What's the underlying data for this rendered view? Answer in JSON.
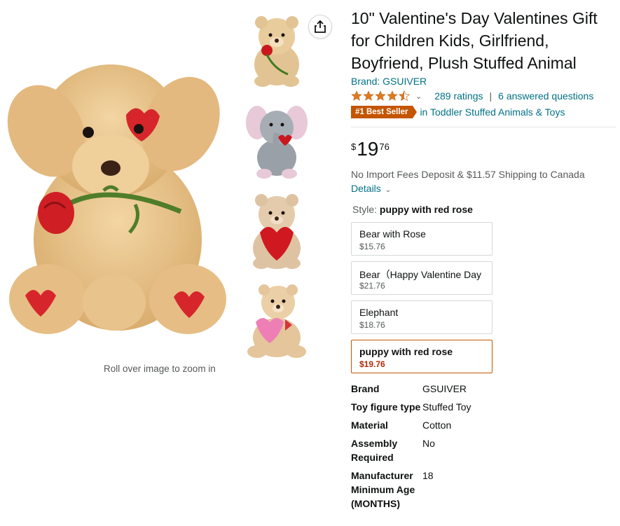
{
  "product": {
    "title": "10\" Valentine's Day Valentines Gift for Children Kids, Girlfriend, Boyfriend, Plush Stuffed Animal",
    "brand_link": "Brand: GSUIVER",
    "rating_value": 4.5,
    "ratings_count": "289 ratings",
    "answered_questions": "6 answered questions",
    "badge": "#1 Best Seller",
    "category_link": "in Toddler Stuffed Animals & Toys",
    "price": {
      "symbol": "$",
      "whole": "19",
      "fraction": "76"
    },
    "shipping": "No Import Fees Deposit & $11.57 Shipping to Canada",
    "details_link": "Details"
  },
  "gallery": {
    "zoom_hint": "Roll over image to zoom in",
    "thumbnails": [
      "bear-with-rose",
      "elephant",
      "bear-i-love-you",
      "bear-happy-valentine"
    ]
  },
  "style": {
    "label": "Style:",
    "selected": "puppy with red rose",
    "options": [
      {
        "name": "Bear with Rose",
        "price": "$15.76"
      },
      {
        "name": "Bear（Happy Valentine Day",
        "price": "$21.76"
      },
      {
        "name": "Elephant",
        "price": "$18.76"
      },
      {
        "name": "puppy with red rose",
        "price": "$19.76"
      }
    ]
  },
  "specs": [
    {
      "key": "Brand",
      "value": "GSUIVER"
    },
    {
      "key": "Toy figure type",
      "value": "Stuffed Toy"
    },
    {
      "key": "Material",
      "value": "Cotton"
    },
    {
      "key": "Assembly Required",
      "value": "No"
    },
    {
      "key": "Manufacturer Minimum Age (MONTHS)",
      "value": "18"
    }
  ],
  "colors": {
    "link": "#007185",
    "badge": "#c45500",
    "star": "#de7921",
    "price_red": "#b12704"
  },
  "icons": {
    "share": "share-icon",
    "chevron": "chevron-down-icon",
    "star": "star-icon"
  }
}
